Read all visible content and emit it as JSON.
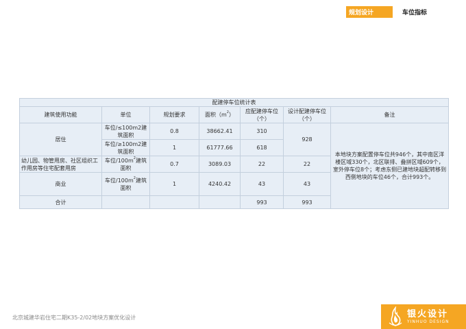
{
  "header": {
    "tab_planning": "规划设计",
    "tab_parking": "车位指标"
  },
  "table": {
    "title": "配建停车位统计表",
    "headers": {
      "function": "建筑使用功能",
      "unit": "单位",
      "requirement": "规划要求",
      "area_prefix": "面积（m",
      "area_sup": "2",
      "area_suffix": "）",
      "required": "应配建停车位（个）",
      "designed": "设计配建停车位（个）",
      "note": "备注"
    },
    "rows": {
      "residential_label": "居住",
      "res1": {
        "unit": "车位/≤100m2建筑面积",
        "requirement": "0.8",
        "area": "38662.41",
        "required": "310"
      },
      "res2": {
        "unit": "车位/≥100m2建筑面积",
        "requirement": "1",
        "area": "61777.66",
        "required": "618"
      },
      "residential_designed": "928",
      "supporting": {
        "label": "幼儿园、物管用房、社区组织工作用房等住宅配套用房",
        "unit_a": "车位/100m",
        "unit_sup": "2",
        "unit_b": "建筑面积",
        "requirement": "0.7",
        "area": "3089.03",
        "required": "22",
        "designed": "22"
      },
      "commercial": {
        "label": "商业",
        "unit_a": "车位/100m",
        "unit_sup": "2",
        "unit_b": "建筑面积",
        "requirement": "1",
        "area": "4240.42",
        "required": "43",
        "designed": "43"
      },
      "total": {
        "label": "合计",
        "required": "993",
        "designed": "993"
      }
    },
    "note_text": "本地块方案配置停车位共946个，其中南区洋楼区域330个，北区联排、叠拼区域609个，室外停车位8个；考虑东侧已建地块超配转移到西侧地块的车位46个，合计993个。"
  },
  "footer": {
    "project": "北京城建华岩住宅二期K35-2/02地块方案优化设计",
    "logo_cn": "银火设计",
    "logo_en": "YINHUO DESIGN"
  },
  "colors": {
    "accent": "#f5a623",
    "table_bg": "#e7eef6",
    "table_border": "#c3cfdd"
  }
}
